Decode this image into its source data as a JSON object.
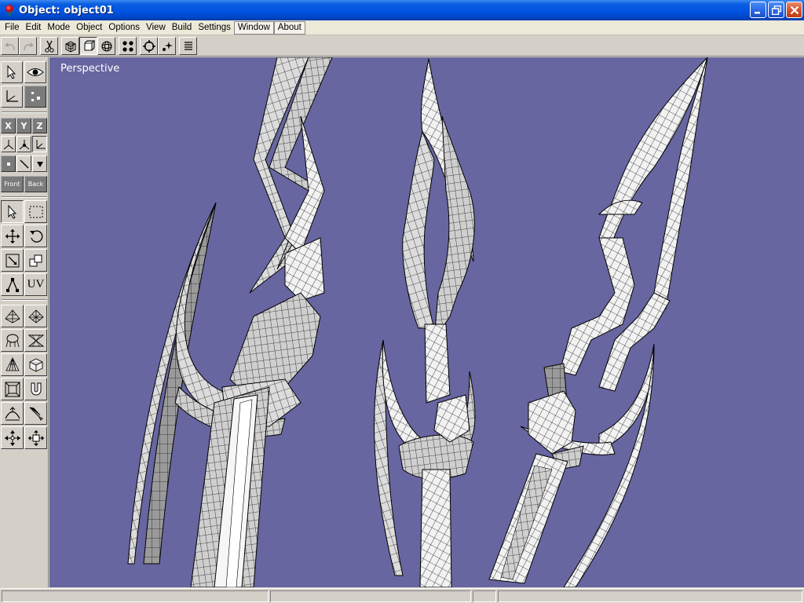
{
  "window": {
    "title": "Object: object01",
    "icon": "rose-icon"
  },
  "menu": {
    "items": [
      "File",
      "Edit",
      "Mode",
      "Object",
      "Options",
      "View",
      "Build",
      "Settings",
      "Window",
      "About"
    ]
  },
  "toolbar": {
    "buttons": [
      "undo-icon",
      "redo-icon",
      "scissors-icon",
      "wireframe-cube-icon",
      "shaded-cube-icon",
      "sphere-icon",
      "vertex-grid-icon",
      "target-icon",
      "sparkle-star-icon",
      "list-icon"
    ]
  },
  "left_panel": {
    "axis_buttons": [
      "X",
      "Y",
      "Z"
    ],
    "view_buttons": [
      "Front",
      "Back"
    ],
    "uv_label": "UV"
  },
  "viewport": {
    "label": "Perspective",
    "background": "#6766a0"
  },
  "colors": {
    "titlebar": "#0054e3",
    "viewport_bg": "#6766a0",
    "mesh_fill": "#e4e4e4",
    "mesh_shadow": "#8a8a8a",
    "wire": "#000000"
  }
}
